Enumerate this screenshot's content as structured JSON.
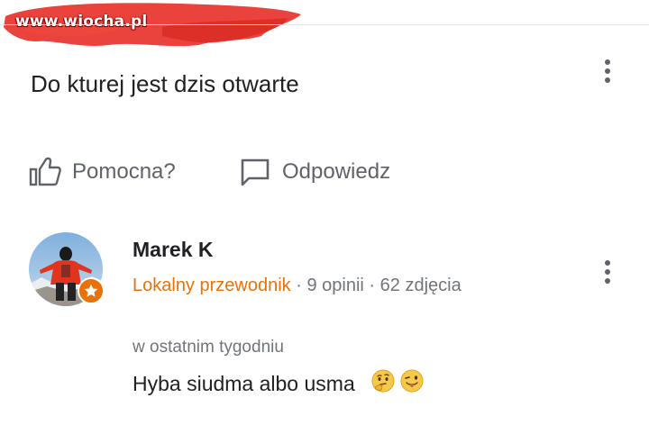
{
  "watermark": {
    "text": "www.wiocha.pl"
  },
  "question": {
    "text": "Do kturej jest dzis otwarte"
  },
  "actions": {
    "helpful_label": "Pomocna?",
    "reply_label": "Odpowiedz"
  },
  "answer": {
    "author_name": "Marek K",
    "guide_label": "Lokalny przewodnik",
    "separator": "·",
    "reviews": "9 opinii",
    "photos": "62 zdjęcia",
    "time": "w ostatnim tygodniu",
    "text": "Hyba siudma albo usma"
  },
  "icons": {
    "menu": "more-vert-icon",
    "helpful": "thumb-up-icon",
    "reply": "comment-icon",
    "badge": "star-icon",
    "emoji1": "thinking-face-icon",
    "emoji2": "winking-tongue-face-icon"
  },
  "colors": {
    "accent_orange": "#e8710a",
    "secondary_text": "#5f6368",
    "watermark_red": "#e8322b"
  }
}
